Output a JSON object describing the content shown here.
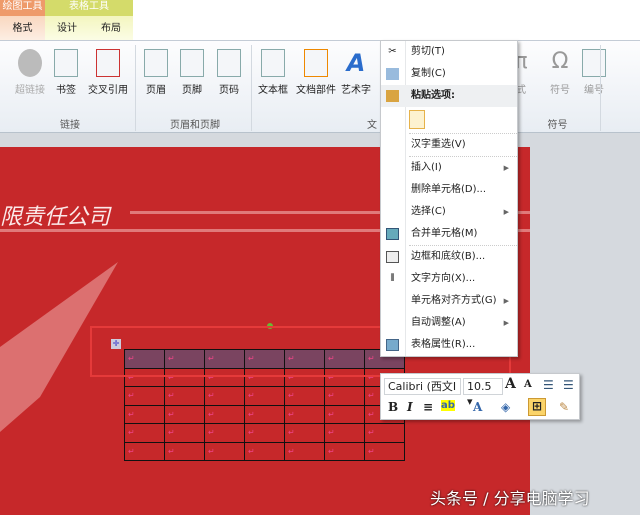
{
  "tabs": {
    "drawing_tools": "绘图工具",
    "format": "格式",
    "table_tools": "表格工具",
    "design": "设计",
    "layout": "布局"
  },
  "ribbon": {
    "buttons": [
      "超链接",
      "书签",
      "交叉引用",
      "页眉",
      "页脚",
      "页码",
      "文本框",
      "文档部件",
      "艺术字",
      "式",
      "符号",
      "编号"
    ],
    "groups": [
      "链接",
      "页眉和页脚",
      "文",
      "符号"
    ]
  },
  "slide": {
    "title": "限责任公司"
  },
  "context_menu": {
    "items": [
      "剪切(T)",
      "复制(C)",
      "粘贴选项:",
      "汉字重选(V)",
      "插入(I)",
      "删除单元格(D)...",
      "选择(C)",
      "合并单元格(M)",
      "边框和底纹(B)...",
      "文字方向(X)...",
      "单元格对齐方式(G)",
      "自动调整(A)",
      "表格属性(R)..."
    ]
  },
  "mini_toolbar": {
    "font": "Calibri (西文Ⅰ",
    "size": "10.5",
    "bold": "B",
    "italic": "I",
    "grow": "A",
    "shrink": "A"
  },
  "watermark": "头条号 / 分享电脑学习"
}
